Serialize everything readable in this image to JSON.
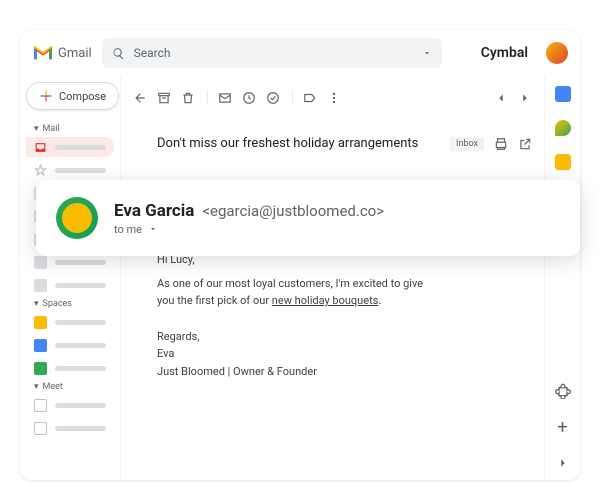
{
  "header": {
    "product": "Gmail",
    "search_placeholder": "Search",
    "brand": "Cymbal"
  },
  "compose": {
    "label": "Compose"
  },
  "sidebar": {
    "sections": {
      "mail": "Mail",
      "spaces": "Spaces",
      "meet": "Meet"
    }
  },
  "toolbar": {
    "back": "Back",
    "archive": "Archive",
    "delete": "Delete",
    "mark_unread": "Mark unread",
    "snooze": "Snooze",
    "add_task": "Add to tasks",
    "labels": "Labels",
    "more": "More",
    "prev": "Newer",
    "next": "Older"
  },
  "message": {
    "subject": "Don't miss our freshest holiday arrangements",
    "inbox_chip": "Inbox",
    "print": "Print",
    "open_new": "Open in new window"
  },
  "sender": {
    "name": "Eva Garcia",
    "email": "<egarcia@justbloomed.co>",
    "to_line": "to me"
  },
  "body": {
    "greeting": "Hi Lucy,",
    "line1": "As one of our most loyal customers, I'm excited to give you the first pick of our ",
    "link1": "new holiday bouquets",
    "period": ".",
    "regards": "Regards,",
    "sig_name": "Eva",
    "sig_title": "Just Bloomed | Owner & Founder"
  },
  "rightrail": {
    "calendar": "Calendar",
    "keep": "Keep",
    "tasks": "Tasks",
    "contacts": "Contacts",
    "add": "Get Add-ons",
    "collapse": "Hide side panel"
  }
}
